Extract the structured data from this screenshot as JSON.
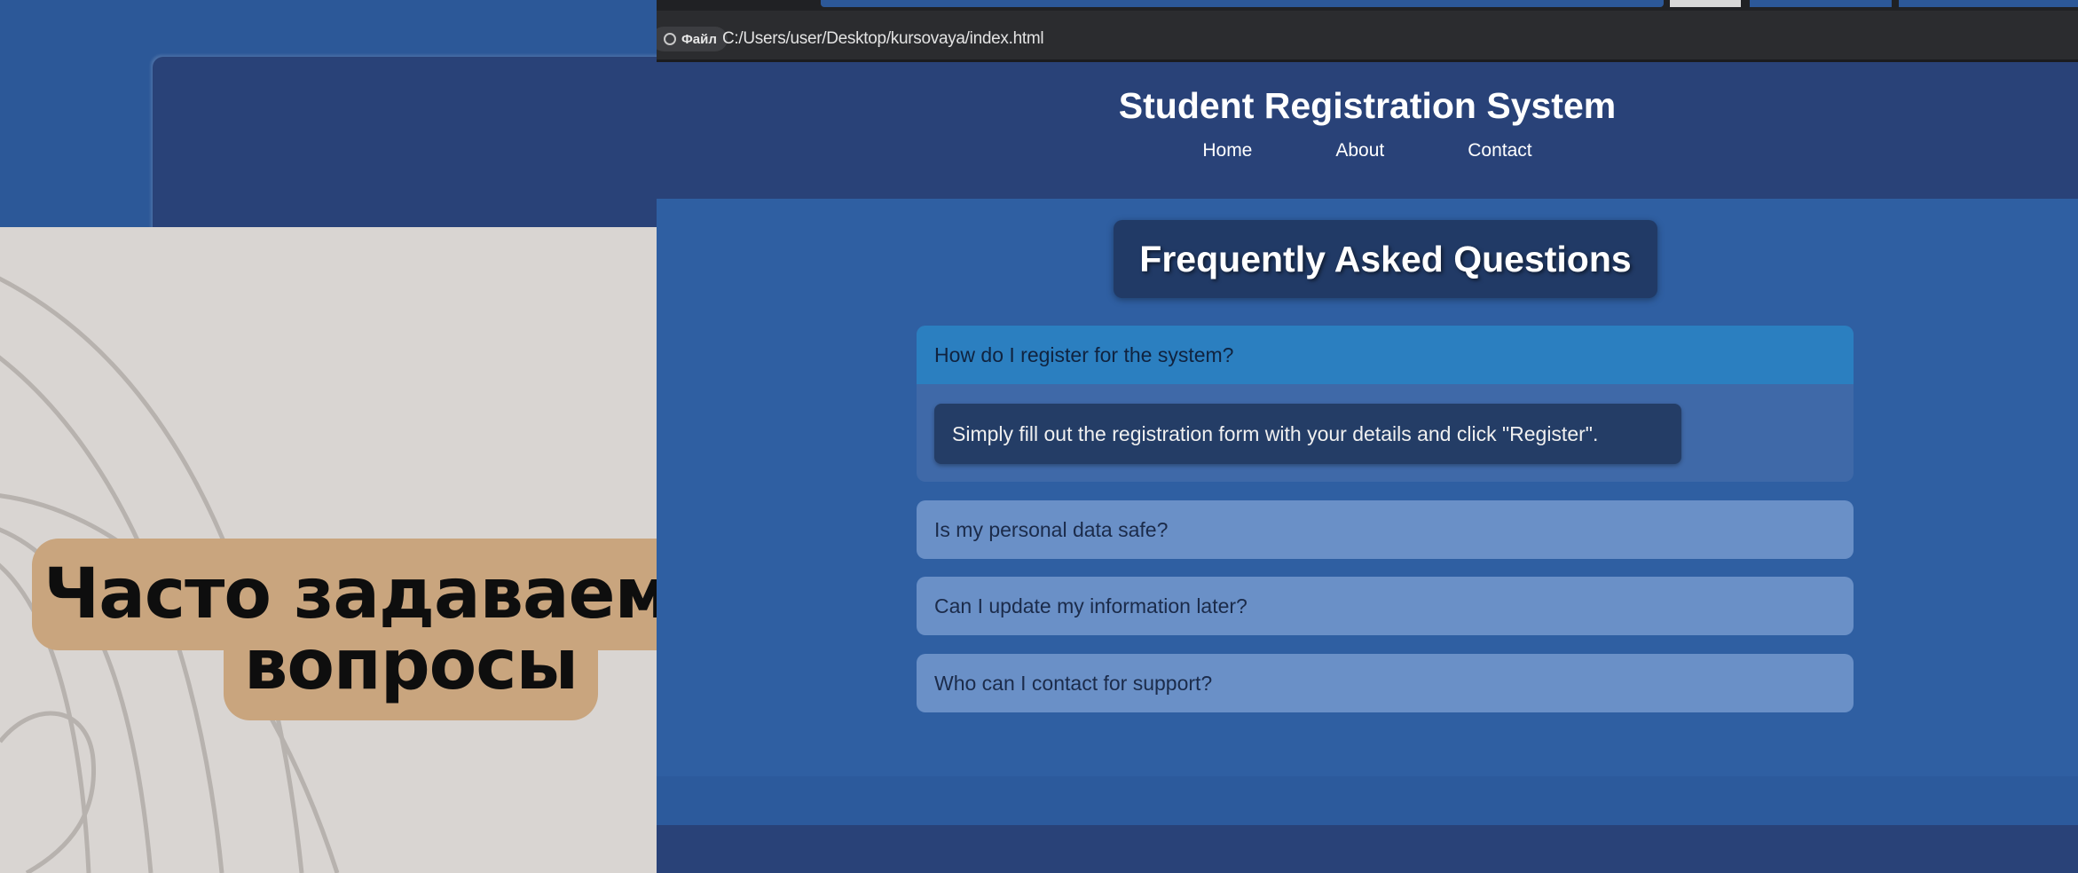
{
  "slide": {
    "title_line1": "Часто задаваемые",
    "title_line2": "вопросы"
  },
  "browser": {
    "file_chip_label": "Файл",
    "url": "C:/Users/user/Desktop/kursovaya/index.html"
  },
  "site": {
    "title": "Student Registration System",
    "nav": [
      "Home",
      "About",
      "Contact"
    ]
  },
  "faq": {
    "heading": "Frequently Asked Questions",
    "open_item": {
      "question": "How do I register for the system?",
      "answer": "Simply fill out the registration form with your details and click \"Register\"."
    },
    "items": [
      "Is my personal data safe?",
      "Can I update my information later?",
      "Who can I contact for support?"
    ]
  },
  "colors": {
    "page_blue": "#2f5fa2",
    "header_navy": "#294278",
    "open_question": "#2b7fc0",
    "collapsed_question": "#6a90c7",
    "slide_beige": "#d9d5d2",
    "title_pill": "#c9a57e"
  },
  "icons": {
    "address_bar": "info-icon"
  }
}
